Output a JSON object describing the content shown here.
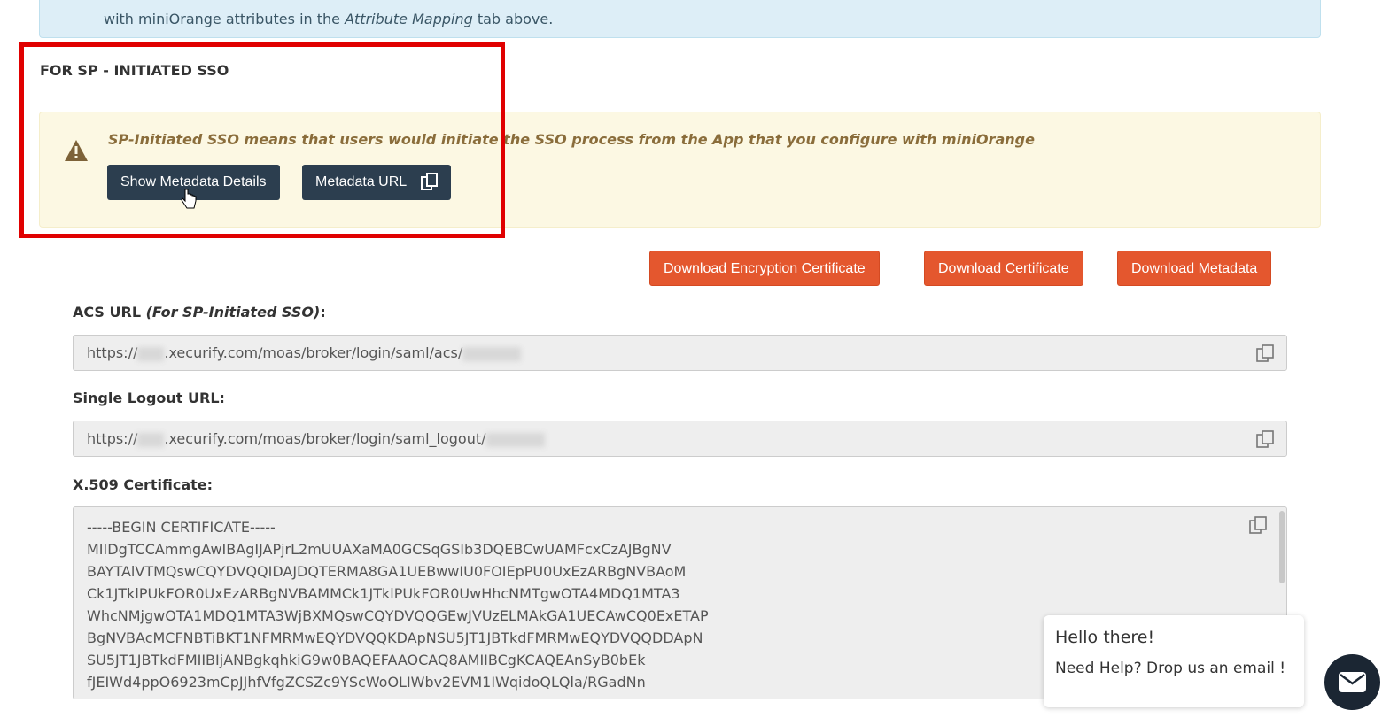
{
  "info_banner": {
    "text_before": "with miniOrange attributes in the ",
    "text_italic": "Attribute Mapping",
    "text_after": " tab above."
  },
  "section": {
    "title": "FOR SP - INITIATED SSO"
  },
  "warning": {
    "icon": "warning-triangle-icon",
    "text": "SP-Initiated SSO means that users would initiate the SSO process from the App that you configure with miniOrange",
    "show_metadata_label": "Show Metadata Details",
    "metadata_url_label": "Metadata URL"
  },
  "downloads": {
    "encryption_cert": "Download Encryption Certificate",
    "certificate": "Download Certificate",
    "metadata": "Download Metadata"
  },
  "acs": {
    "label": "ACS URL ",
    "label_italic": "(For SP-Initiated SSO)",
    "label_suffix": ":",
    "prefix": "https://",
    "value": ".xecurify.com/moas/broker/login/saml/acs/"
  },
  "slo": {
    "label": "Single Logout URL:",
    "prefix": "https://",
    "value": ".xecurify.com/moas/broker/login/saml_logout/"
  },
  "cert": {
    "label": "X.509 Certificate:",
    "lines": [
      "-----BEGIN CERTIFICATE-----",
      "MIIDgTCCAmmgAwIBAgIJAPjrL2mUUAXaMA0GCSqGSIb3DQEBCwUAMFcxCzAJBgNV",
      "BAYTAlVTMQswCQYDVQQIDAJDQTERMA8GA1UEBwwIU0FOIEpPU0UxEzARBgNVBAoM",
      "Ck1JTklPUkFOR0UxEzARBgNVBAMMCk1JTklPUkFOR0UwHhcNMTgwOTA4MDQ1MTA3",
      "WhcNMjgwOTA1MDQ1MTA3WjBXMQswCQYDVQQGEwJVUzELMAkGA1UECAwCQ0ExETAP",
      "BgNVBAcMCFNBTiBKT1NFMRMwEQYDVQQKDApNSU5JT1JBTkdFMRMwEQYDVQQDDApN",
      "SU5JT1JBTkdFMIIBIjANBgkqhkiG9w0BAQEFAAOCAQ8AMIIBCgKCAQEAnSyB0bEk",
      "fJEIWd4ppO6923mCpJJhfVfgZCSZc9YScWoOLIWbv2EVM1IWqidoQLQla/RGadNn"
    ]
  },
  "chat": {
    "greeting": "Hello there!",
    "subtext": "Need Help? Drop us an email !"
  },
  "colors": {
    "accent_orange": "#e4572e",
    "dark_button": "#2c3e4f",
    "highlight_red": "#e00000"
  }
}
